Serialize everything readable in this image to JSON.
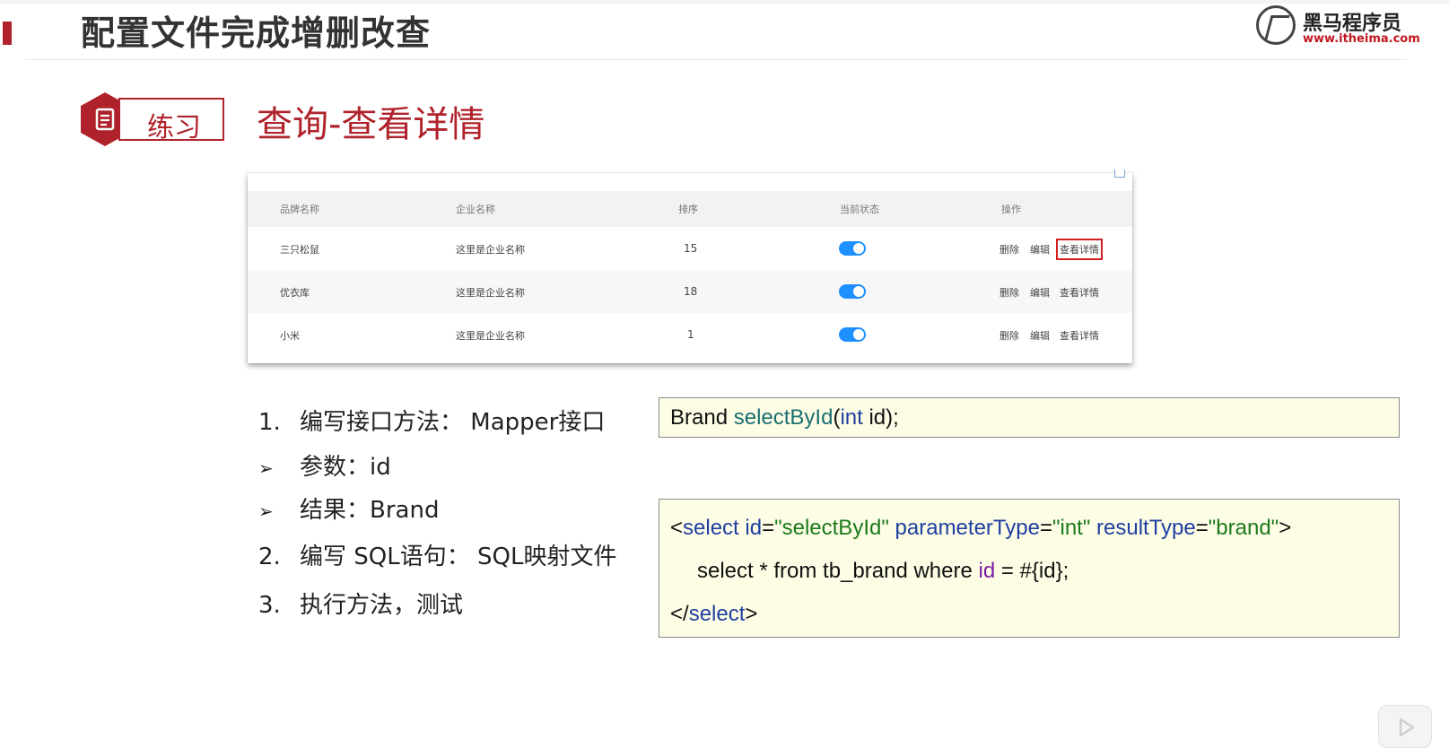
{
  "header": {
    "title": "配置文件完成增删改查",
    "logo_name": "黑马程序员",
    "logo_url": "www.itheima.com"
  },
  "badge": {
    "label": "练习"
  },
  "section_title": "查询-查看详情",
  "table": {
    "headers": [
      "品牌名称",
      "企业名称",
      "排序",
      "当前状态",
      "操作"
    ],
    "rows": [
      {
        "brand": "三只松鼠",
        "company": "这里是企业名称",
        "order": "15",
        "enabled": true
      },
      {
        "brand": "优衣库",
        "company": "这里是企业名称",
        "order": "18",
        "enabled": true
      },
      {
        "brand": "小米",
        "company": "这里是企业名称",
        "order": "1",
        "enabled": true
      }
    ],
    "actions": {
      "delete": "删除",
      "edit": "编辑",
      "detail": "查看详情"
    }
  },
  "steps": [
    {
      "marker": "1.",
      "text": "编写接口方法： Mapper接口"
    },
    {
      "marker": "➢",
      "text": "参数：id"
    },
    {
      "marker": "➢",
      "text": "结果：Brand"
    },
    {
      "marker": "2.",
      "text": "编写 SQL语句： SQL映射文件"
    },
    {
      "marker": "3.",
      "text": "执行方法，测试"
    }
  ],
  "code_interface": {
    "type": "Brand",
    "method": "selectById",
    "open_paren": "(",
    "param_type": "int",
    "param_rest": " id);"
  },
  "code_xml": {
    "l1_open": "<",
    "l1_tag": "select",
    "l1_id_attr": " id",
    "l1_eq1": "=",
    "l1_id_val": "\"selectById\"",
    "l1_pt_attr": " parameterType",
    "l1_eq2": "=",
    "l1_pt_val": "\"int\"",
    "l1_rt_attr": " resultType",
    "l1_eq3": "=",
    "l1_rt_val": "\"brand\"",
    "l1_close": ">",
    "l2_pre": "select * from tb_brand where ",
    "l2_id": "id",
    "l2_post": " = #{id};",
    "l3_open": "</",
    "l3_tag": "select",
    "l3_close": ">"
  },
  "colors": {
    "accent": "#b0222b",
    "toggle": "#1e90ff",
    "code_bg": "#fdfde6"
  },
  "icons": {
    "badge": "document-icon",
    "logo": "horse-logo-icon",
    "play": "play-icon"
  }
}
